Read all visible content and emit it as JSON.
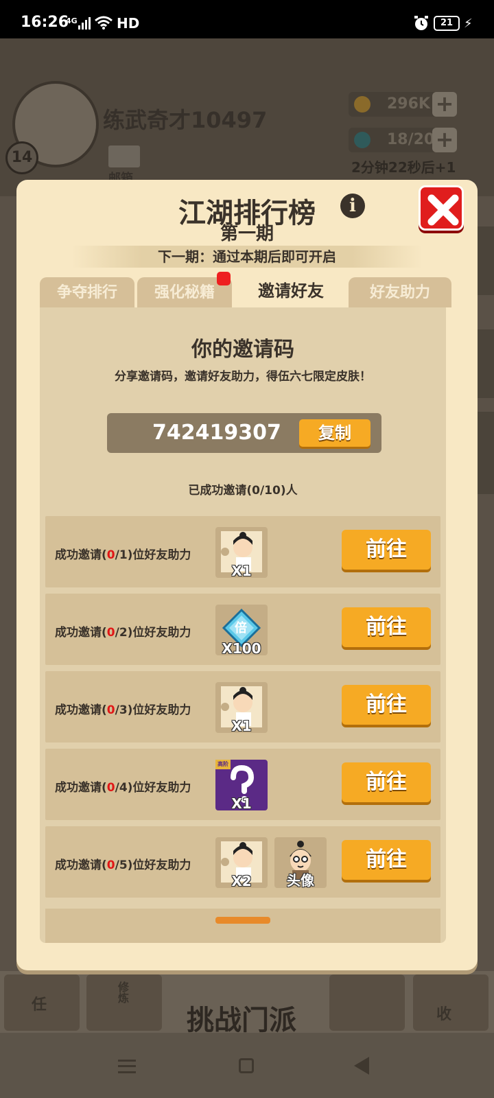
{
  "status_bar": {
    "time": "16:26",
    "network": "4G",
    "hd": "HD",
    "battery": "21"
  },
  "background": {
    "player_name": "练武奇才10497",
    "level": "14",
    "mail_label": "邮箱",
    "coins": "296K",
    "energy": "18/20",
    "energy_timer": "2分钟22秒后+1",
    "challenge_label": "挑战门派",
    "task_label": "任",
    "train_label": "修炼",
    "collect_label": "收"
  },
  "dialog": {
    "title": "江湖排行榜",
    "period": "第一期",
    "next_period": "下一期：通过本期后即可开启",
    "tabs": [
      {
        "label": "争夺排行",
        "active": false
      },
      {
        "label": "强化秘籍",
        "active": false,
        "badge": true
      },
      {
        "label": "邀请好友",
        "active": true
      },
      {
        "label": "好友助力",
        "active": false
      }
    ],
    "invite": {
      "heading": "你的邀请码",
      "description": "分享邀请码，邀请好友助力，得伍六七限定皮肤！",
      "code": "742419307",
      "copy_label": "复制",
      "invited_summary": "已成功邀请(0/10)人"
    },
    "rewards": [
      {
        "prefix": "成功邀请(",
        "current": "0",
        "rest": "/1)位好友助力",
        "items": [
          {
            "type": "character",
            "qty": "X1"
          }
        ],
        "button": "前往"
      },
      {
        "prefix": "成功邀请(",
        "current": "0",
        "rest": "/2)位好友助力",
        "items": [
          {
            "type": "gem",
            "glyph": "倍",
            "qty": "X100"
          }
        ],
        "button": "前往"
      },
      {
        "prefix": "成功邀请(",
        "current": "0",
        "rest": "/3)位好友助力",
        "items": [
          {
            "type": "character",
            "qty": "X1"
          }
        ],
        "button": "前往"
      },
      {
        "prefix": "成功邀请(",
        "current": "0",
        "rest": "/4)位好友助力",
        "items": [
          {
            "type": "mystery",
            "tag": "高阶",
            "qty": "X1"
          }
        ],
        "button": "前往"
      },
      {
        "prefix": "成功邀请(",
        "current": "0",
        "rest": "/5)位好友助力",
        "items": [
          {
            "type": "character",
            "qty": "X2"
          },
          {
            "type": "avatar",
            "qty": "头像"
          }
        ],
        "button": "前往"
      }
    ]
  },
  "colors": {
    "accent_button": "#f6aa24",
    "close_red": "#e01d1d",
    "panel": "#f8e8c4",
    "highlight_red": "#e11616"
  }
}
